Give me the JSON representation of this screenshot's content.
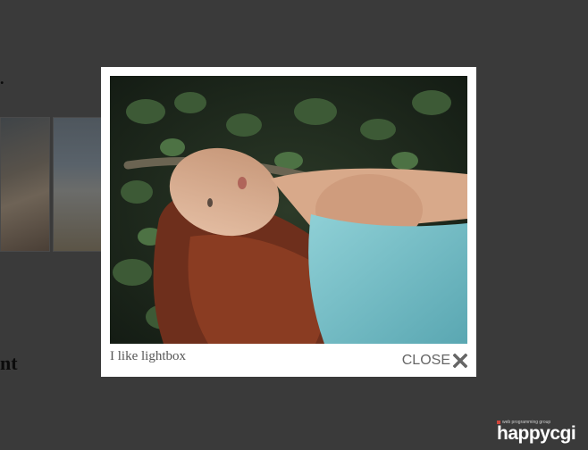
{
  "lightbox": {
    "caption": "I like lightbox",
    "close_label": "CLOSE",
    "close_icon": "close-icon"
  },
  "background": {
    "heading_fragment": "nt",
    "top_fragment": "."
  },
  "logo": {
    "tagline": "web programming group",
    "name": "happycgi"
  }
}
